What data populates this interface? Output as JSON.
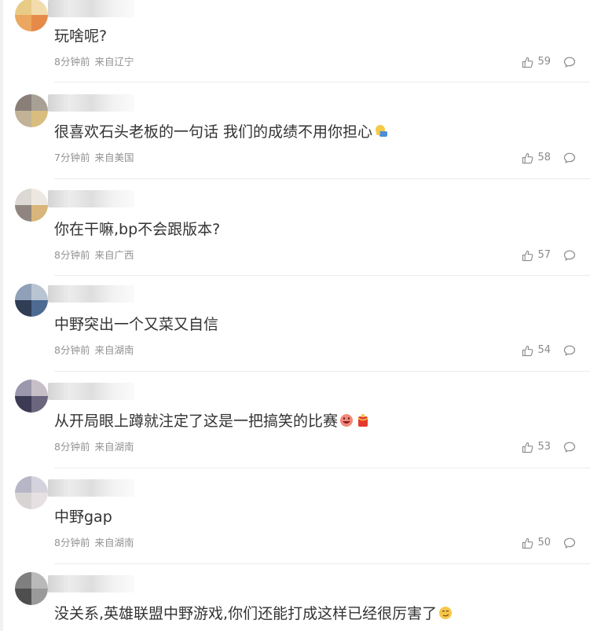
{
  "comments": [
    {
      "text": "玩啥呢?",
      "time": "8分钟前",
      "location": "来自辽宁",
      "likes": "59",
      "avatar": [
        "#e8cc86",
        "#f2dcae",
        "#eba75f",
        "#e58a49"
      ],
      "emoji": []
    },
    {
      "text": "很喜欢石头老板的一句话 我们的成绩不用你担心",
      "time": "7分钟前",
      "location": "来自美国",
      "likes": "58",
      "avatar": [
        "#8a7f78",
        "#a9a095",
        "#c2b398",
        "#d9bd7e"
      ],
      "emoji": [
        "facepalm-emoji"
      ]
    },
    {
      "text": "你在干嘛,bp不会跟版本?",
      "time": "8分钟前",
      "location": "来自广西",
      "likes": "57",
      "avatar": [
        "#dcd8d4",
        "#ede7e1",
        "#8f857e",
        "#d8b57a"
      ],
      "emoji": []
    },
    {
      "text": "中野突出一个又菜又自信",
      "time": "8分钟前",
      "location": "来自湖南",
      "likes": "54",
      "avatar": [
        "#8fa0b8",
        "#b9c4d3",
        "#2f3d55",
        "#4d6a92"
      ],
      "emoji": []
    },
    {
      "text": "从开局眼上蹲就注定了这是一把搞笑的比赛",
      "time": "8分钟前",
      "location": "来自湖南",
      "likes": "53",
      "avatar": [
        "#9b97ad",
        "#c7bfc7",
        "#3c3a55",
        "#6b657e"
      ],
      "emoji": [
        "laughing-face-emoji",
        "red-packet-emoji"
      ]
    },
    {
      "text": "中野gap",
      "time": "8分钟前",
      "location": "来自湖南",
      "likes": "50",
      "avatar": [
        "#b6b6c6",
        "#d4d2dc",
        "#d8d4d4",
        "#e6e0e2"
      ],
      "emoji": []
    },
    {
      "text": "没关系,英雄联盟中野游戏,你们还能打成这样已经很厉害了",
      "time": "",
      "location": "",
      "likes": "",
      "avatar": [
        "#7f7f7f",
        "#b9b9b9",
        "#4e4e4e",
        "#9a9a9a"
      ],
      "emoji": [
        "smirk-emoji"
      ]
    }
  ],
  "colors": {
    "text": "#333333",
    "meta": "#939393",
    "separator": "#ececec"
  }
}
